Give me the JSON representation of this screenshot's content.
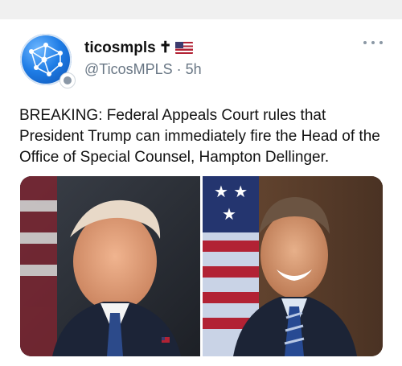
{
  "author": {
    "display_name": "ticosmpls",
    "name_cross": "✝",
    "name_flag": "us-flag-icon",
    "handle": "@TicosMPLS",
    "separator": "·",
    "time_ago": "5h"
  },
  "post": {
    "text": "BREAKING: Federal Appeals Court rules that President Trump can immediately fire the Head of the Office of Special Counsel, Hampton Dellinger."
  },
  "icons": {
    "avatar": "globe-network-icon",
    "badge": "government-badge-icon",
    "more": "more-options-icon"
  }
}
